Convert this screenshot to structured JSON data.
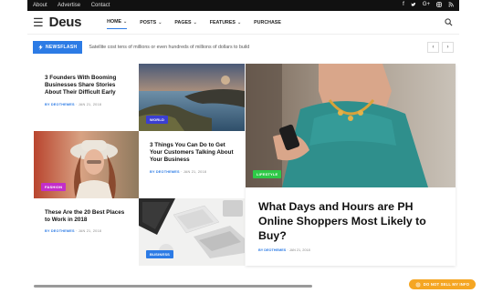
{
  "topbar": {
    "links": [
      "About",
      "Advertise",
      "Contact"
    ],
    "social_icons": [
      "facebook-icon",
      "twitter-icon",
      "google-plus-icon",
      "instagram-icon",
      "rss-icon"
    ]
  },
  "nav": {
    "logo": "Deus",
    "menu": [
      {
        "label": "HOME",
        "has_caret": true,
        "active": true
      },
      {
        "label": "POSTS",
        "has_caret": true
      },
      {
        "label": "PAGES",
        "has_caret": true
      },
      {
        "label": "FEATURES",
        "has_caret": true
      },
      {
        "label": "PURCHASE",
        "has_caret": false
      }
    ],
    "caret": "⌄"
  },
  "ticker": {
    "badge_label": "NEWSFLASH",
    "text": "Satellite cost tens of millions or even hundreds of millions of dollars to build",
    "prev": "‹",
    "next": "›"
  },
  "articles": [
    {
      "title": "3 Founders With Booming Businesses Share Stories About Their Difficult Early",
      "author": "BY DEOTHEMES",
      "date": "JAN 21, 2018"
    },
    {
      "category": "WORLD"
    },
    {
      "category": "FASHION"
    },
    {
      "title": "3 Things You Can Do to Get Your Customers Talking About Your Business",
      "author": "BY DEOTHEMES",
      "date": "JAN 21, 2018"
    },
    {
      "title": "These Are the 20 Best Places to Work in 2018",
      "author": "BY DEOTHEMES",
      "date": "JAN 21, 2018"
    },
    {
      "category": "BUSINESS"
    }
  ],
  "featured": {
    "category": "LIFESTYLE",
    "title": "What Days and Hours are PH Online Shoppers Most Likely to Buy?",
    "author": "BY DEOTHEMES",
    "date": "JAN 21, 2018"
  },
  "dnsmi": {
    "label": "DO NOT SELL MY INFO"
  },
  "colors": {
    "accent": "#2c7be5",
    "world": "#3b3fd1",
    "fashion": "#c32ec9",
    "business": "#2c7be5",
    "lifestyle": "#2ec947",
    "dnsmi": "#f5a623"
  }
}
